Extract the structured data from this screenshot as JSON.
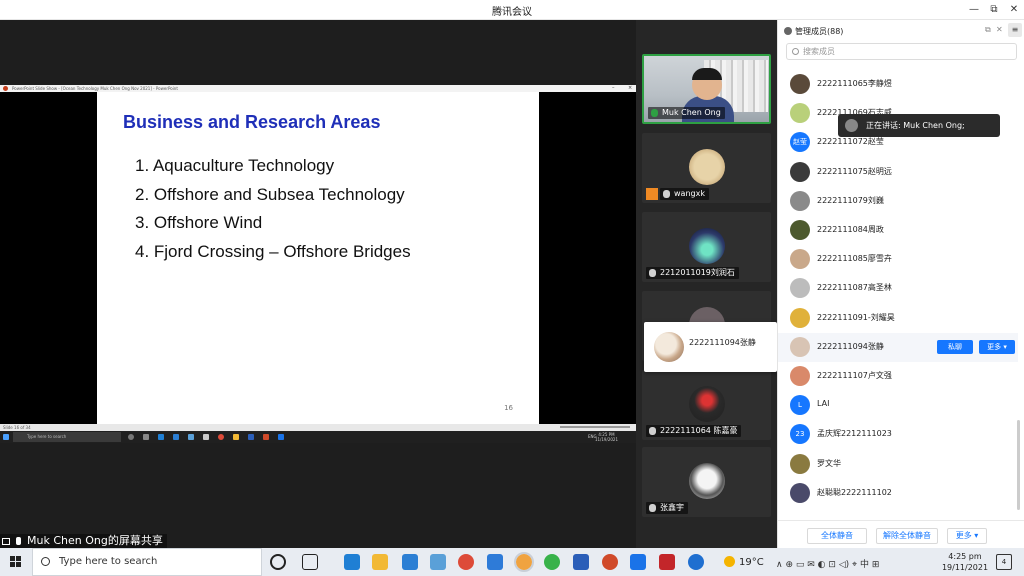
{
  "window": {
    "title": "腾讯会议",
    "controls": [
      "—",
      "⧉",
      "✕"
    ]
  },
  "share": {
    "powerpoint_title": "PowerPoint Slide Show - [Ocean Technology Muk Chen Ong Nov 2021] - PowerPoint",
    "slide_title": "Business and Research Areas",
    "slide_items": [
      "1.  Aquaculture Technology",
      "2.  Offshore and Subsea Technology",
      "3.  Offshore Wind",
      "4.  Fjord Crossing – Offshore Bridges"
    ],
    "slide_page": "16",
    "status_left": "Slide 16 of 34",
    "inner_search_placeholder": "Type here to search",
    "inner_clock_time": "4:25 PM",
    "inner_clock_date": "11/19/2021",
    "inner_lang": "ENG",
    "sharing_label": "Muk Chen Ong的屏幕共享"
  },
  "videos": {
    "tiles": [
      {
        "name": "Muk Chen Ong"
      },
      {
        "name": "wangxk"
      },
      {
        "name": "2212011019刘润石"
      },
      {
        "name": ""
      },
      {
        "name": "2222111064 陈嘉豪"
      },
      {
        "name": "张鑫宇"
      }
    ],
    "hover_card_name": "2222111094张静"
  },
  "panel": {
    "title": "管理成员(88)",
    "search_placeholder": "搜索成员",
    "menu_label": "≡",
    "members": [
      {
        "name": "2222111065李静煜",
        "avatar_text": "",
        "color": "#5a4a3a"
      },
      {
        "name": "2222111069石志威",
        "avatar_text": "",
        "color": "#b9d07a"
      },
      {
        "name": "2222111072赵莹",
        "avatar_text": "赵莹",
        "color": "#1677ff"
      },
      {
        "name": "2222111075赵明远",
        "avatar_text": "",
        "color": "#3a3a3a"
      },
      {
        "name": "2222111079刘巍",
        "avatar_text": "",
        "color": "#8a8a8a"
      },
      {
        "name": "2222111084周政",
        "avatar_text": "",
        "color": "#4d5a2e"
      },
      {
        "name": "2222111085廖雪卉",
        "avatar_text": "",
        "color": "#c9a88a"
      },
      {
        "name": "2222111087高圣林",
        "avatar_text": "",
        "color": "#bcbcbc"
      },
      {
        "name": "2222111091-刘耀昊",
        "avatar_text": "",
        "color": "#e0b13a"
      },
      {
        "name": "2222111094张静",
        "avatar_text": "",
        "color": "#d8c4b4"
      },
      {
        "name": "2222111107卢文强",
        "avatar_text": "",
        "color": "#d9896a"
      },
      {
        "name": "LAI",
        "avatar_text": "L",
        "color": "#1677ff"
      },
      {
        "name": "孟庆辉2212111023",
        "avatar_text": "23",
        "color": "#1677ff"
      },
      {
        "name": "罗文华",
        "avatar_text": "",
        "color": "#8a7a40"
      },
      {
        "name": "赵聪聪2222111102",
        "avatar_text": "",
        "color": "#4a4a6a"
      }
    ],
    "row_actions": {
      "private_chat": "私聊",
      "more": "更多 ▾"
    },
    "speaking_tooltip": "正在讲话: Muk Chen Ong;",
    "footer": {
      "mute_all": "全体静音",
      "unmute_all": "解除全体静音",
      "more": "更多 ▾"
    }
  },
  "taskbar": {
    "search_placeholder": "Type here to search",
    "weather": "19°C",
    "tray": "∧  ⊕  ▭  ✉  ◐  ⊡  ◁)  ⌖  中  ⊞",
    "clock_time": "4:25 pm",
    "clock_date": "19/11/2021",
    "notification_count": "4",
    "colors": {
      "edge": "#1f7fd4",
      "explorer": "#f2b935",
      "mail": "#2c7fd4",
      "ide": "#5aa0d8",
      "chrome": "#dd4b39",
      "calendar": "#2e7bd8",
      "meeting": "#f0a340",
      "wechat": "#38b24a",
      "word": "#2b5eb8",
      "powerpoint": "#d04a2a",
      "tencent": "#1a73e8",
      "pdf": "#c3262a",
      "help": "#1f6fd0"
    }
  }
}
